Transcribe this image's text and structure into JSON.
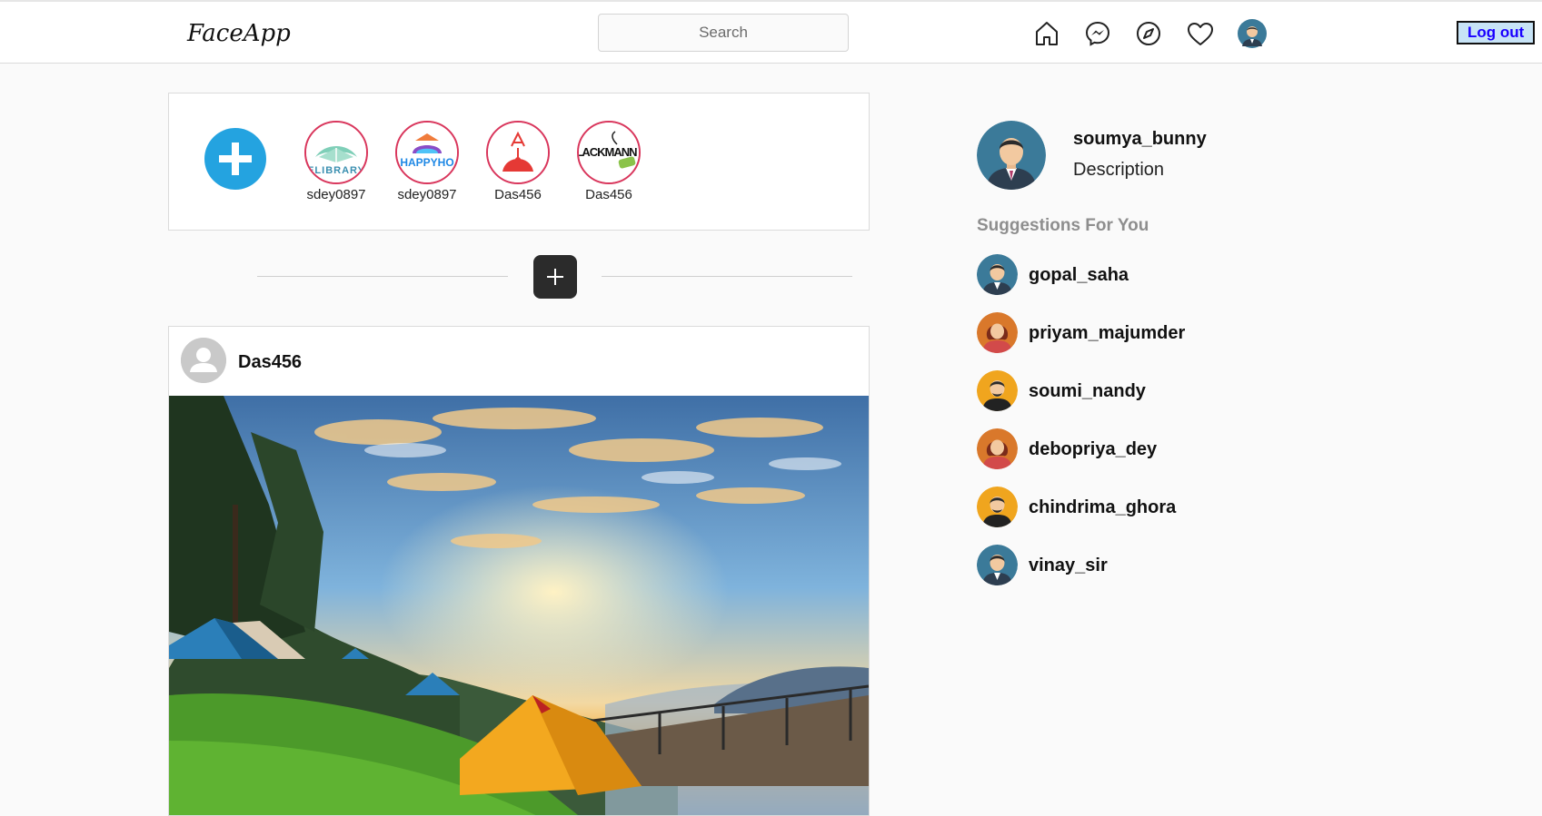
{
  "app": {
    "logo": "FaceApp",
    "search": {
      "placeholder": "Search",
      "value": ""
    },
    "nav_icons": [
      "home-icon",
      "messenger-icon",
      "explore-compass-icon",
      "heart-icon",
      "profile-avatar-icon"
    ],
    "logout_label": "Log out"
  },
  "stories": {
    "add_icon": "plus-icon",
    "items": [
      {
        "user": "sdey0897",
        "logo_text": "ELIBRARY"
      },
      {
        "user": "sdey0897",
        "logo_text": "HAPPYHO"
      },
      {
        "user": "Das456",
        "logo_text": ""
      },
      {
        "user": "Das456",
        "logo_text": "LACKMANN"
      }
    ]
  },
  "new_post_icon": "plus-icon",
  "post": {
    "user": "Das456",
    "image": "camping-tents-sunset-landscape"
  },
  "sidebar": {
    "profile": {
      "username": "soumya_bunny",
      "description": "Description"
    },
    "suggestions_title": "Suggestions For You",
    "suggestions": [
      {
        "username": "gopal_saha",
        "avatar": "male-suit-avatar"
      },
      {
        "username": "priyam_majumder",
        "avatar": "female-avatar"
      },
      {
        "username": "soumi_nandy",
        "avatar": "male-yellow-avatar"
      },
      {
        "username": "debopriya_dey",
        "avatar": "female-avatar"
      },
      {
        "username": "chindrima_ghora",
        "avatar": "male-yellow-avatar"
      },
      {
        "username": "vinay_sir",
        "avatar": "male-suit-avatar"
      }
    ]
  },
  "colors": {
    "story_ring": "#d9365c",
    "add_story": "#24a3e0",
    "logout_bg": "#c7e3f6",
    "logout_text": "#1a00ff",
    "suggestions_title": "#8e8e8e"
  }
}
